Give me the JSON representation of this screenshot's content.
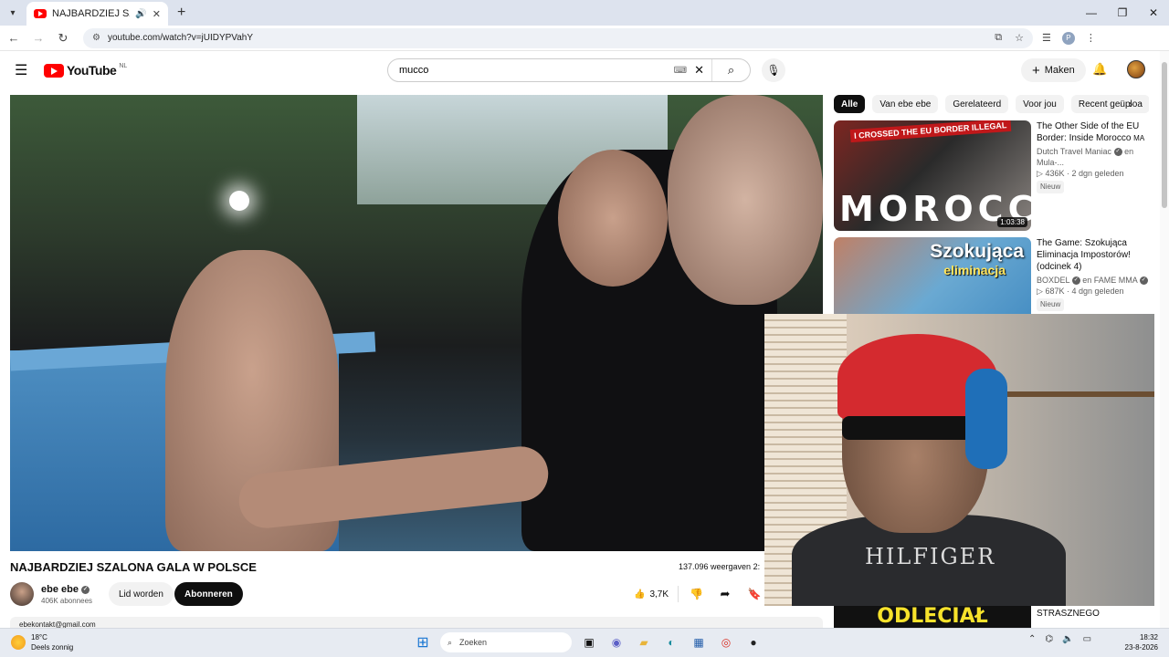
{
  "browser": {
    "tab_title": "NAJBARDZIEJ SZALONA GA",
    "tab_audio_icon": "speaker-icon",
    "url": "youtube.com/watch?v=jUIDYPVahY",
    "window_controls": [
      "—",
      "❐",
      "✕"
    ]
  },
  "youtube": {
    "logo_text": "YouTube",
    "region": "NL",
    "search_value": "mucco",
    "create_label": "Maken"
  },
  "video": {
    "title": "NAJBARDZIEJ SZALONA GALA W POLSCE",
    "views": "137.096 weergaven 2:",
    "channel_name": "ebe ebe",
    "subscribers": "406K abonnees",
    "join_label": "Lid worden",
    "subscribe_label": "Abonneren",
    "likes": "3,7K",
    "description_peek": "ebekontakt@gmail.com"
  },
  "overlay": {
    "shirt_text": "HILFIGER"
  },
  "chips": [
    "Alle",
    "Van ebe ebe",
    "Gerelateerd",
    "Voor jou",
    "Recent geüploa"
  ],
  "recommendations": [
    {
      "title": "The Other Side of the EU Border: Inside Morocco",
      "title_suffix": "MA",
      "channel": "Dutch Travel Maniac",
      "channel_suffix": "en Mula-...",
      "stats": "436K · 2 dgn geleden",
      "badge": "Nieuw",
      "duration": "1:03:38",
      "thumb_text": "MOROCCO",
      "thumb_top": "I CROSSED THE EU BORDER ILLEGAL"
    },
    {
      "title": "The Game: Szokująca Eliminacja Impostorów! (odcinek 4)",
      "channel": "BOXDEL",
      "channel_suffix": "en FAME MMA",
      "stats": "687K · 4 dgn geleden",
      "badge": "Nieuw",
      "thumb_text": "Szokująca",
      "thumb_text_2": "eliminacja"
    },
    {
      "thumb_text": "ODLECIAŁ",
      "title": "STRASZNEGO"
    }
  ],
  "taskbar": {
    "temperature": "18°C",
    "weather_desc": "Deels zonnig",
    "search_placeholder": "Zoeken",
    "time": "18:32",
    "date": "23-8-2026"
  }
}
